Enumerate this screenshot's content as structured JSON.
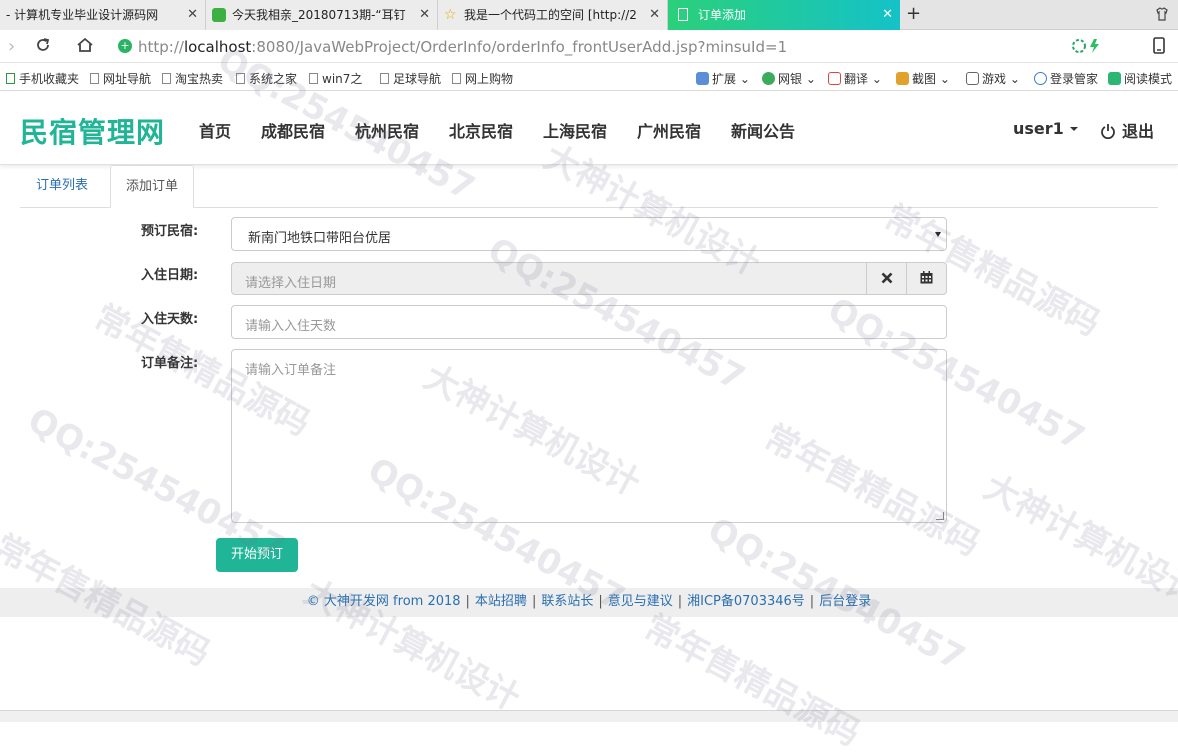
{
  "browser": {
    "tabs": [
      {
        "title": "- 计算机专业毕业设计源码网"
      },
      {
        "title": "今天我相亲_20180713期-“耳钉"
      },
      {
        "title": "我是一个代码工的空间 [http://2"
      },
      {
        "title": "订单添加"
      }
    ],
    "url_scheme": "http://",
    "url_host": "localhost",
    "url_path": ":8080/JavaWebProject/OrderInfo/orderInfo_frontUserAdd.jsp?minsuId=1",
    "bookmarks": [
      "手机收藏夹",
      "网址导航",
      "淘宝热卖",
      "系统之家",
      "win7之",
      "足球导航",
      "网上购物"
    ],
    "tools": [
      "扩展",
      "网银",
      "翻译",
      "截图",
      "游戏",
      "登录管家",
      "阅读模式"
    ],
    "accent_color": "#1fb596"
  },
  "site": {
    "brand": "民宿管理网",
    "nav": [
      "首页",
      "成都民宿",
      "杭州民宿",
      "北京民宿",
      "上海民宿",
      "广州民宿",
      "新闻公告"
    ],
    "user": "user1",
    "logout": "退出"
  },
  "page_tabs": {
    "list": "订单列表",
    "add": "添加订单"
  },
  "form": {
    "minsu_label": "预订民宿:",
    "minsu_value": "新南门地铁口带阳台优居",
    "date_label": "入住日期:",
    "date_placeholder": "请选择入住日期",
    "days_label": "入住天数:",
    "days_placeholder": "请输入入住天数",
    "memo_label": "订单备注:",
    "memo_placeholder": "请输入订单备注",
    "submit": "开始预订"
  },
  "footer": {
    "copyright": "© 大神开发网 from 2018",
    "links": [
      "本站招聘",
      "联系站长",
      "意见与建议",
      "湘ICP备0703346号",
      "后台登录"
    ]
  },
  "watermarks": [
    "QQ:254540457",
    "常年售精品源码",
    "大神计算机设计"
  ]
}
